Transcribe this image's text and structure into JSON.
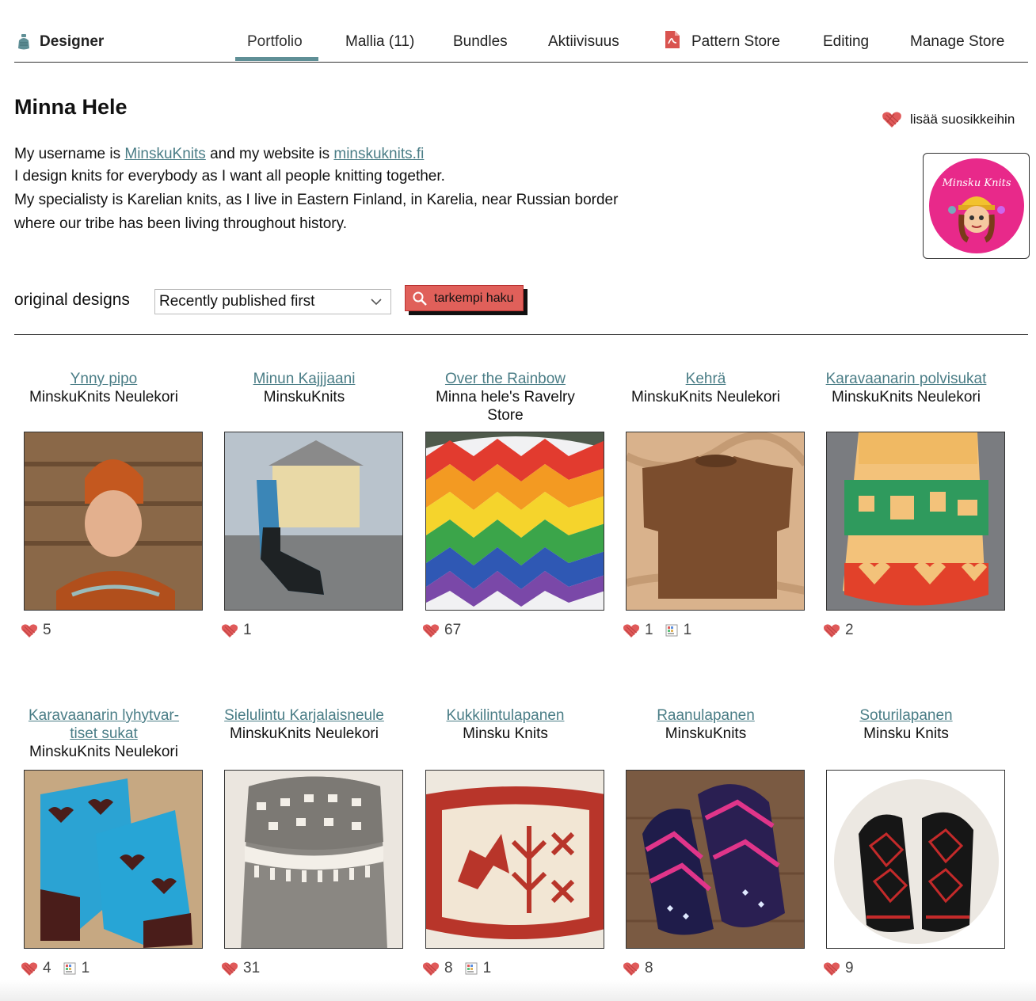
{
  "nav": {
    "designer_label": "Designer",
    "tabs": [
      "Portfolio",
      "Mallia (11)",
      "Bundles",
      "Aktiivisuus",
      "Pattern Store",
      "Editing",
      "Manage Store"
    ],
    "active": "Portfolio"
  },
  "profile": {
    "name": "Minna Hele",
    "favorite_label": "lisää suosikkeihin",
    "bio_prefix": "My username is ",
    "username": "MinskuKnits",
    "bio_mid": " and my website is ",
    "website": "minskuknits.fi",
    "bio_line2": "I design knits for everybody as I want all people knitting together.",
    "bio_line3": "My specialisty is Karelian knits, as I live in Eastern Finland, in Karelia, near Russian border",
    "bio_line4": "where our tribe has been living throughout history.",
    "avatar_text": "Minsku Knits"
  },
  "filter": {
    "label": "original designs",
    "sort_selected": "Recently published first",
    "search_button": "tarkempi haku"
  },
  "designs": [
    {
      "name": "Ynny pipo",
      "store": "MinskuKnits Neulekori",
      "hearts": "5",
      "projects": ""
    },
    {
      "name": "Minun Kajjjaani",
      "store": "MinskuKnits",
      "hearts": "1",
      "projects": ""
    },
    {
      "name": "Over the Rainbow",
      "store": "Minna hele's Ravelry Store",
      "hearts": "67",
      "projects": ""
    },
    {
      "name": "Kehrä",
      "store": "MinskuKnits Neulekori",
      "hearts": "1",
      "projects": "1"
    },
    {
      "name": "Karavaanarin polvisukat",
      "store": "MinskuKnits Neulekori",
      "hearts": "2",
      "projects": ""
    },
    {
      "name": "Karavaanarin lyhytvar-tiset sukat",
      "store": "MinskuKnits Neulekori",
      "hearts": "4",
      "projects": "1"
    },
    {
      "name": "Sielulintu Karjalaisneule",
      "store": "MinskuKnits Neulekori",
      "hearts": "31",
      "projects": ""
    },
    {
      "name": "Kukkilintulapanen",
      "store": "Minsku Knits",
      "hearts": "8",
      "projects": "1"
    },
    {
      "name": "Raanulapanen",
      "store": "MinskuKnits",
      "hearts": "8",
      "projects": ""
    },
    {
      "name": "Soturilapanen",
      "store": "Minsku Knits",
      "hearts": "9",
      "projects": ""
    }
  ],
  "colors": {
    "link": "#4a7d86",
    "accent_tab": "#5f8f96",
    "search_button": "#e0605a",
    "heart": "#e05a5a"
  }
}
